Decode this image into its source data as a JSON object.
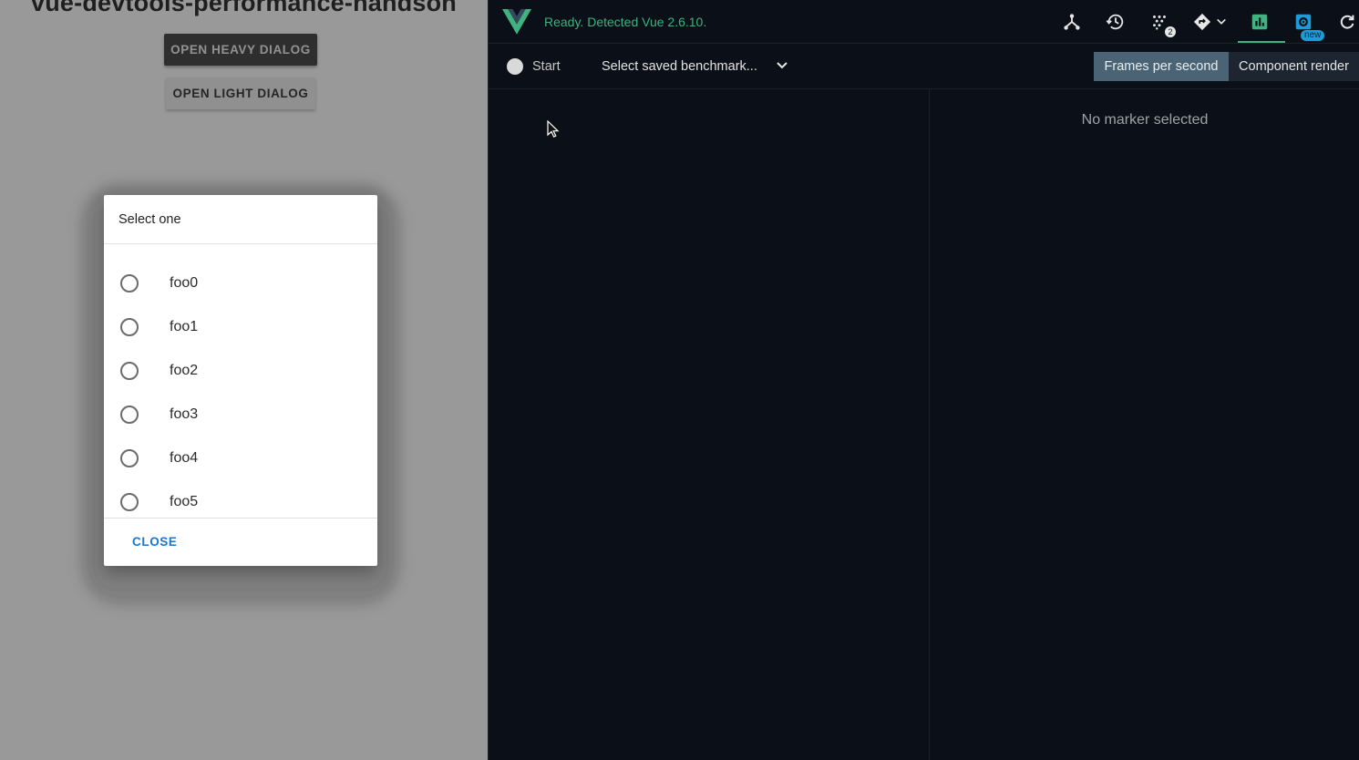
{
  "app": {
    "title": "vue-devtools-performance-handson",
    "open_heavy_label": "OPEN HEAVY DIALOG",
    "open_light_label": "OPEN LIGHT DIALOG"
  },
  "dialog": {
    "title": "Select one",
    "options": [
      "foo0",
      "foo1",
      "foo2",
      "foo3",
      "foo4",
      "foo5"
    ],
    "close_label": "CLOSE"
  },
  "devtools": {
    "status": "Ready. Detected Vue 2.6.10.",
    "vuex_badge": "2",
    "new_badge": "new",
    "record_label": "Start",
    "benchmark_select": "Select saved benchmark...",
    "tabs": [
      "Frames per second",
      "Component render"
    ],
    "no_marker": "No marker selected",
    "accent_color": "#3fb27f",
    "toolbar_icons": [
      "components-icon",
      "history-icon",
      "vuex-icon",
      "router-icon",
      "performance-icon",
      "settings-icon",
      "refresh-icon"
    ]
  }
}
